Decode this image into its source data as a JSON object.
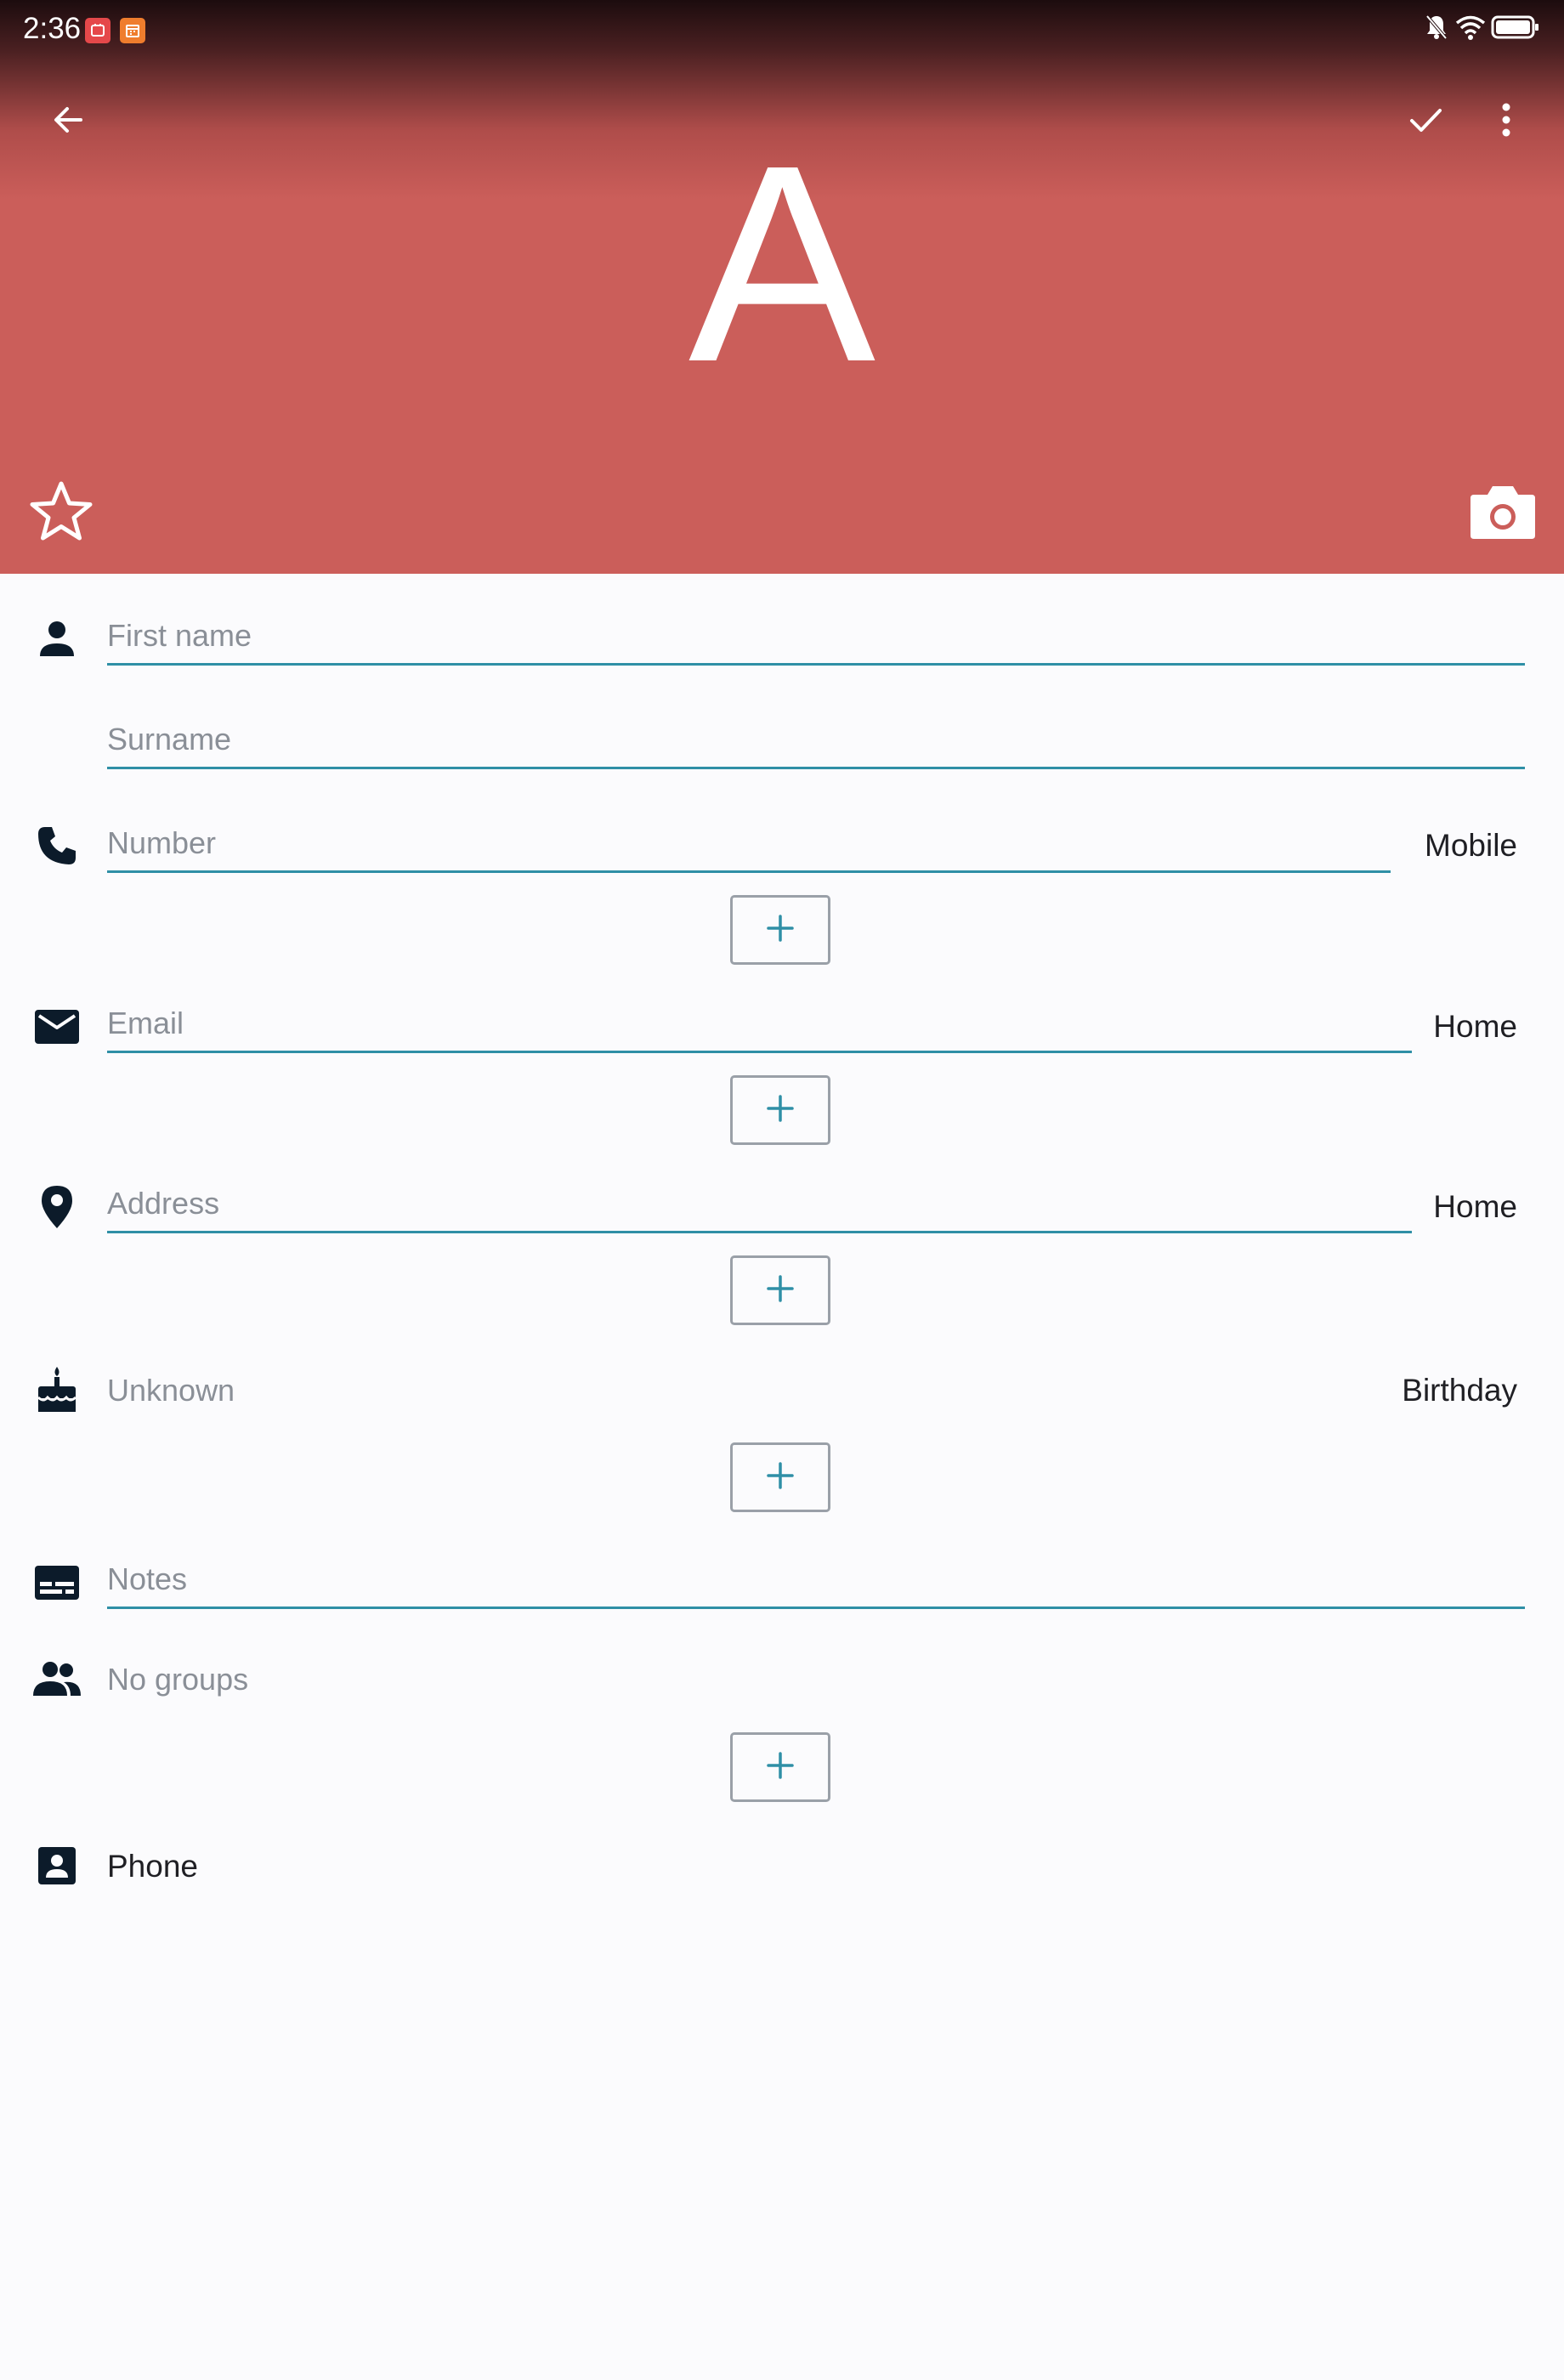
{
  "status_bar": {
    "time": "2:36",
    "notification_icons": [
      "app-notification-icon",
      "calendar-notification-icon"
    ],
    "right_icons": [
      "silent-bell-icon",
      "wifi-icon",
      "battery-icon"
    ]
  },
  "app_bar": {
    "back_icon": "arrow-left-icon",
    "save_icon": "check-icon",
    "menu_icon": "more-vert-icon"
  },
  "header": {
    "avatar_letter": "A",
    "background_color": "#cb5e5a",
    "favorite_icon": "star-outline-icon",
    "camera_icon": "camera-icon"
  },
  "form": {
    "first_name": {
      "placeholder": "First name",
      "value": ""
    },
    "surname": {
      "placeholder": "Surname",
      "value": ""
    },
    "phone": {
      "placeholder": "Number",
      "value": "",
      "type": "Mobile"
    },
    "email": {
      "placeholder": "Email",
      "value": "",
      "type": "Home"
    },
    "address": {
      "placeholder": "Address",
      "value": "",
      "type": "Home"
    },
    "event": {
      "value": "Unknown",
      "type": "Birthday"
    },
    "notes": {
      "placeholder": "Notes",
      "value": ""
    },
    "groups": {
      "value": "No groups"
    },
    "source": {
      "value": "Phone"
    },
    "add_button_label": "+"
  },
  "colors": {
    "accent": "#2f8fa6",
    "icon": "#0c1b2a",
    "text_primary": "#1f1f24",
    "text_hint": "#8a8f97"
  }
}
